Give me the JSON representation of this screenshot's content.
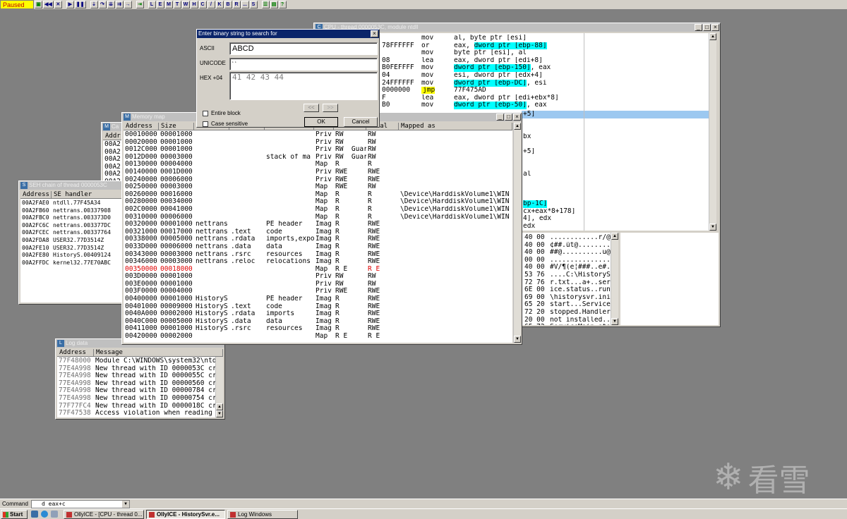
{
  "toolbar": {
    "status": "Paused",
    "buttons": [
      "L",
      "E",
      "M",
      "T",
      "W",
      "H",
      "C",
      "/",
      "K",
      "B",
      "R",
      "...",
      "S"
    ]
  },
  "cpu": {
    "title": "CPU - thread 0000053C, module ntdll",
    "disasm": [
      {
        "hex": "",
        "mn": "mov",
        "op": "al, byte ptr [esi]"
      },
      {
        "hex": "78FFFFFF",
        "mn": "or",
        "op": "eax, ",
        "hl": "dword ptr [ebp-88]"
      },
      {
        "hex": "",
        "mn": "mov",
        "op": "byte ptr [esi], al"
      },
      {
        "hex": "08",
        "mn": "lea",
        "op": "eax, dword ptr [edi+8]"
      },
      {
        "hex": "B0FEFFFF",
        "mn": "mov",
        "op": "",
        "hl": "dword ptr [ebp-150]",
        "tail": ", eax"
      },
      {
        "hex": "04",
        "mn": "mov",
        "op": "esi, dword ptr [edx+4]"
      },
      {
        "hex": "24FFFFFF",
        "mn": "mov",
        "op": "",
        "hl": "dword ptr [ebp-DC]",
        "tail": ", esi"
      },
      {
        "hex": "0000000",
        "mn": "jmp",
        "op": "77F475AD",
        "jmp": true
      },
      {
        "hex": "F",
        "mn": "lea",
        "op": "eax, dword ptr [edi+ebx*8]"
      },
      {
        "hex": "B0",
        "mn": "mov",
        "op": "",
        "hl": "dword ptr [ebp-50]",
        "tail": ", eax"
      }
    ],
    "frag": [
      {
        "t": "+5]"
      },
      {
        "t": ""
      },
      {
        "t": ""
      },
      {
        "t": "bx"
      },
      {
        "t": ""
      },
      {
        "t": "+5]"
      },
      {
        "t": ""
      },
      {
        "t": ""
      },
      {
        "t": "al"
      },
      {
        "t": ""
      },
      {
        "t": ""
      },
      {
        "t": ""
      },
      {
        "t": "bp-1C]",
        "hl": true
      },
      {
        "t": "cx+eax*8+178]"
      },
      {
        "t": "4], edx"
      },
      {
        "t": "edx"
      }
    ],
    "dump": [
      {
        "hex": "40 00",
        "ascii": "............r/@."
      },
      {
        "hex": "40 00",
        "ascii": "¢##.ût@........."
      },
      {
        "hex": "40 00",
        "ascii": "##@..........u@."
      },
      {
        "hex": "00 00",
        "ascii": "................"
      },
      {
        "hex": "40 00",
        "ascii": "#V/¶(e¦###..e#.."
      },
      {
        "hex": "53 76",
        "ascii": "....C:\\HistorySv"
      },
      {
        "hex": "72 76",
        "ascii": "r.txt...a+..serv"
      },
      {
        "hex": "6E 00",
        "ascii": "ice.status..run."
      },
      {
        "hex": "69 00",
        "ascii": "\\historysvr.ini."
      },
      {
        "hex": "65 20",
        "ascii": "start...Service "
      },
      {
        "hex": "72 20",
        "ascii": "stopped.Handler "
      },
      {
        "hex": "20 00",
        "ascii": "not installed..."
      },
      {
        "hex": "65 72",
        "ascii": "ServiceMain stop"
      }
    ]
  },
  "dialog": {
    "title": "Enter binary string to search for",
    "ascii_label": "ASCII",
    "ascii_value": "ABCD",
    "unicode_label": "UNICODE",
    "unicode_value": "‘ ‘",
    "hex_label": "HEX +04",
    "hex_value": "41 42 43 44",
    "prev": "<<",
    "next": ">>",
    "entire_block": "Entire block",
    "case_sensitive": "Case sensitive",
    "ok": "OK",
    "cancel": "Cancel"
  },
  "memmap": {
    "title": "Memory map",
    "columns": [
      "Address",
      "Size",
      "",
      "",
      "",
      "",
      "",
      "itial",
      "Mapped as"
    ],
    "rows": [
      {
        "a": "00010000",
        "s": "00001000",
        "o": "",
        "sec": "",
        "c": "",
        "t": "Priv",
        "acc": "RW",
        "ini": "RW",
        "m": ""
      },
      {
        "a": "00020000",
        "s": "00001000",
        "o": "",
        "sec": "",
        "c": "",
        "t": "Priv",
        "acc": "RW",
        "ini": "RW",
        "m": ""
      },
      {
        "a": "0012C000",
        "s": "00001000",
        "o": "",
        "sec": "",
        "c": "",
        "t": "Priv",
        "acc": "RW  Guar",
        "ini": "RW",
        "m": ""
      },
      {
        "a": "0012D000",
        "s": "00003000",
        "o": "",
        "sec": "",
        "c": "stack of ma",
        "t": "Priv",
        "acc": "RW  Guar",
        "ini": "RW",
        "m": ""
      },
      {
        "a": "00130000",
        "s": "00004000",
        "o": "",
        "sec": "",
        "c": "",
        "t": "Map",
        "acc": "R",
        "ini": "R",
        "m": ""
      },
      {
        "a": "00140000",
        "s": "0001D000",
        "o": "",
        "sec": "",
        "c": "",
        "t": "Priv",
        "acc": "RWE",
        "ini": "RWE",
        "m": ""
      },
      {
        "a": "00240000",
        "s": "00006000",
        "o": "",
        "sec": "",
        "c": "",
        "t": "Priv",
        "acc": "RWE",
        "ini": "RWE",
        "m": ""
      },
      {
        "a": "00250000",
        "s": "00003000",
        "o": "",
        "sec": "",
        "c": "",
        "t": "Map",
        "acc": "RWE",
        "ini": "RW",
        "m": ""
      },
      {
        "a": "00260000",
        "s": "00016000",
        "o": "",
        "sec": "",
        "c": "",
        "t": "Map",
        "acc": "R",
        "ini": "R",
        "m": "\\Device\\HarddiskVolume1\\WIN"
      },
      {
        "a": "00280000",
        "s": "00034000",
        "o": "",
        "sec": "",
        "c": "",
        "t": "Map",
        "acc": "R",
        "ini": "R",
        "m": "\\Device\\HarddiskVolume1\\WIN"
      },
      {
        "a": "002C0000",
        "s": "00041000",
        "o": "",
        "sec": "",
        "c": "",
        "t": "Map",
        "acc": "R",
        "ini": "R",
        "m": "\\Device\\HarddiskVolume1\\WIN"
      },
      {
        "a": "00310000",
        "s": "00006000",
        "o": "",
        "sec": "",
        "c": "",
        "t": "Map",
        "acc": "R",
        "ini": "R",
        "m": "\\Device\\HarddiskVolume1\\WIN"
      },
      {
        "a": "00320000",
        "s": "00001000",
        "o": "nettrans",
        "sec": "",
        "c": "PE header",
        "t": "Imag",
        "acc": "R",
        "ini": "RWE",
        "m": ""
      },
      {
        "a": "00321000",
        "s": "00017000",
        "o": "nettrans",
        "sec": ".text",
        "c": "code",
        "t": "Imag",
        "acc": "R",
        "ini": "RWE",
        "m": ""
      },
      {
        "a": "00338000",
        "s": "00005000",
        "o": "nettrans",
        "sec": ".rdata",
        "c": "imports,expo",
        "t": "Imag",
        "acc": "R",
        "ini": "RWE",
        "m": ""
      },
      {
        "a": "0033D000",
        "s": "00006000",
        "o": "nettrans",
        "sec": ".data",
        "c": "data",
        "t": "Imag",
        "acc": "R",
        "ini": "RWE",
        "m": ""
      },
      {
        "a": "00343000",
        "s": "00003000",
        "o": "nettrans",
        "sec": ".rsrc",
        "c": "resources",
        "t": "Imag",
        "acc": "R",
        "ini": "RWE",
        "m": ""
      },
      {
        "a": "00346000",
        "s": "00003000",
        "o": "nettrans",
        "sec": ".reloc",
        "c": "relocations",
        "t": "Imag",
        "acc": "R",
        "ini": "RWE",
        "m": ""
      },
      {
        "a": "00350000",
        "s": "00018000",
        "o": "",
        "sec": "",
        "c": "",
        "t": "Map",
        "acc": "R E",
        "ini": "R E",
        "m": "",
        "red": true
      },
      {
        "a": "003D0000",
        "s": "00001000",
        "o": "",
        "sec": "",
        "c": "",
        "t": "Priv",
        "acc": "RW",
        "ini": "RW",
        "m": ""
      },
      {
        "a": "003E0000",
        "s": "00001000",
        "o": "",
        "sec": "",
        "c": "",
        "t": "Priv",
        "acc": "RW",
        "ini": "RW",
        "m": ""
      },
      {
        "a": "003F0000",
        "s": "00004000",
        "o": "",
        "sec": "",
        "c": "",
        "t": "Priv",
        "acc": "RWE",
        "ini": "RWE",
        "m": ""
      },
      {
        "a": "00400000",
        "s": "00001000",
        "o": "HistoryS",
        "sec": "",
        "c": "PE header",
        "t": "Imag",
        "acc": "R",
        "ini": "RWE",
        "m": ""
      },
      {
        "a": "00401000",
        "s": "00009000",
        "o": "HistoryS",
        "sec": ".text",
        "c": "code",
        "t": "Imag",
        "acc": "R",
        "ini": "RWE",
        "m": ""
      },
      {
        "a": "0040A000",
        "s": "00002000",
        "o": "HistoryS",
        "sec": ".rdata",
        "c": "imports",
        "t": "Imag",
        "acc": "R",
        "ini": "RWE",
        "m": ""
      },
      {
        "a": "0040C000",
        "s": "00005000",
        "o": "HistoryS",
        "sec": ".data",
        "c": "data",
        "t": "Imag",
        "acc": "R",
        "ini": "RWE",
        "m": ""
      },
      {
        "a": "00411000",
        "s": "00001000",
        "o": "HistoryS",
        "sec": ".rsrc",
        "c": "resources",
        "t": "Imag",
        "acc": "R",
        "ini": "RWE",
        "m": ""
      },
      {
        "a": "00420000",
        "s": "00002000",
        "o": "",
        "sec": "",
        "c": "",
        "t": "Map",
        "acc": "R E",
        "ini": "R E",
        "m": ""
      }
    ]
  },
  "behind": {
    "title": "Ca",
    "header": "Addr",
    "rows": [
      "00A2",
      "00A2",
      "00A2",
      "00A2",
      "00A2",
      "00A2"
    ]
  },
  "seh": {
    "title": "SEH chain of thread 0000053C",
    "columns": [
      "Address",
      "SE handler"
    ],
    "rows": [
      {
        "a": "00A2FAE0",
        "h": "ntdll.77F45A34"
      },
      {
        "a": "00A2FB60",
        "h": "nettrans.00337908"
      },
      {
        "a": "00A2FBC0",
        "h": "nettrans.003373D0"
      },
      {
        "a": "00A2FC6C",
        "h": "nettrans.003377DC"
      },
      {
        "a": "00A2FCEC",
        "h": "nettrans.00337764"
      },
      {
        "a": "00A2FDA8",
        "h": "USER32.77D3514Z"
      },
      {
        "a": "00A2FE10",
        "h": "USER32.77D3514Z"
      },
      {
        "a": "00A2FE80",
        "h": "HistoryS.00409124"
      },
      {
        "a": "00A2FFDC",
        "h": "kernel32.77E70ABC"
      }
    ]
  },
  "log": {
    "title": "Log data",
    "columns": [
      "Address",
      "Message"
    ],
    "rows": [
      {
        "a": "77F48000",
        "m": "Module C:\\WINDOWS\\system32\\ntd"
      },
      {
        "a": "77E4A998",
        "m": "New thread with ID 0000053C cr"
      },
      {
        "a": "77E4A998",
        "m": "New thread with ID 0000055C cr"
      },
      {
        "a": "77E4A998",
        "m": "New thread with ID 00000560 cr"
      },
      {
        "a": "77E4A998",
        "m": "New thread with ID 00000784 cr"
      },
      {
        "a": "77E4A998",
        "m": "New thread with ID 00000754 cr"
      },
      {
        "a": "77F77FC4",
        "m": "New thread with ID 0000018C cr"
      },
      {
        "a": "77F47538",
        "m": "Access violation when reading"
      }
    ]
  },
  "command": {
    "label": "Command",
    "value": "d eax+c"
  },
  "taskbar": {
    "start": "Start",
    "tasks": [
      "OllyICE - [CPU - thread 0...",
      "OllyICE - HistorySvr.e...",
      "Log Windows"
    ]
  },
  "watermark": {
    "text": "看雪"
  }
}
